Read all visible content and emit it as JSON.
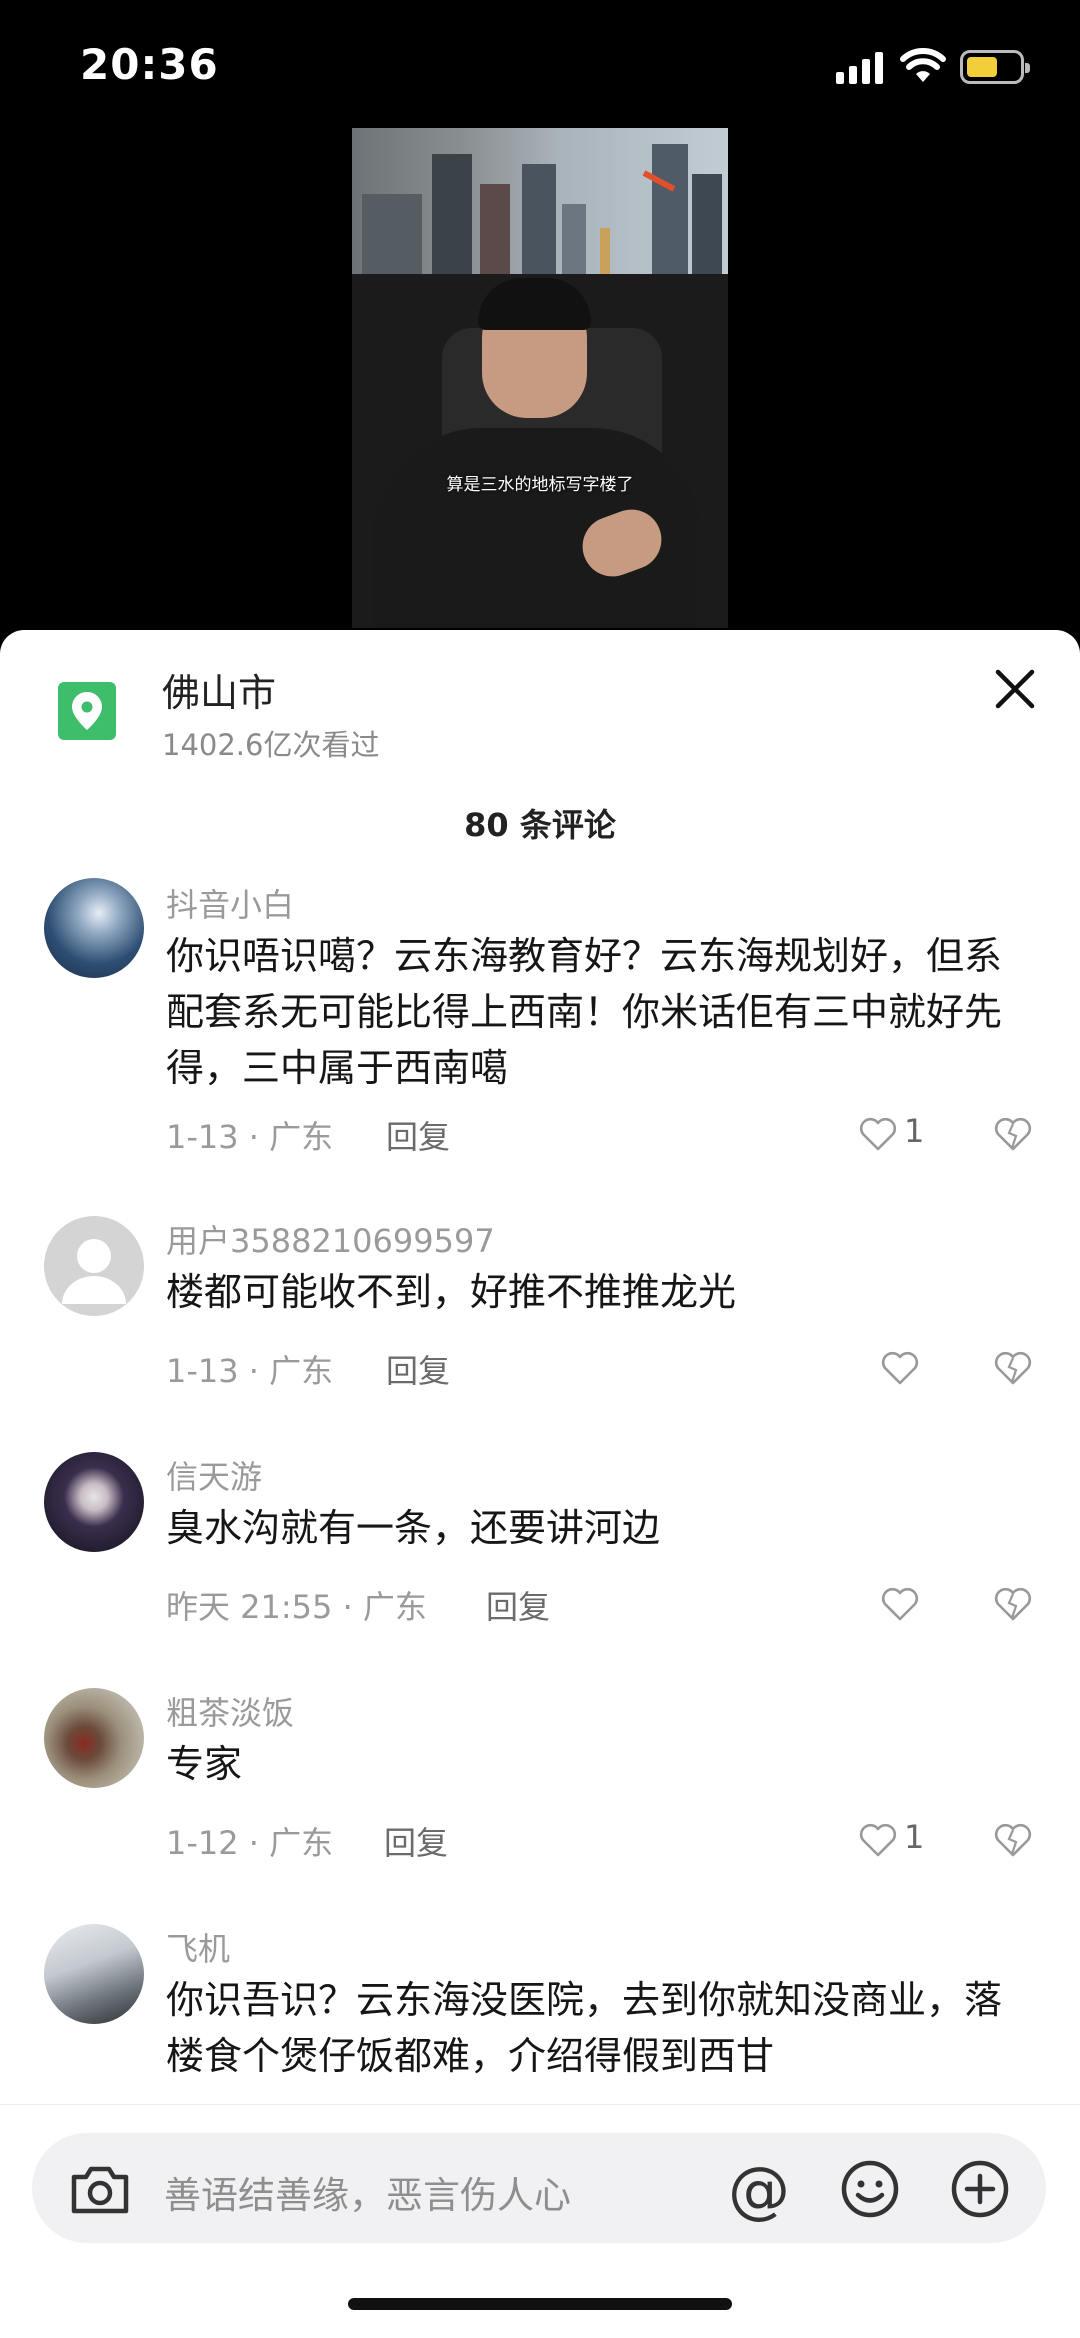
{
  "status_bar": {
    "time": "20:36"
  },
  "video": {
    "caption": "算是三水的地标写字楼了"
  },
  "location": {
    "title": "佛山市",
    "views": "1402.6亿次看过"
  },
  "comments_header": "80 条评论",
  "comments": [
    {
      "user": "抖音小白",
      "text": "你识唔识噶？云东海教育好？云东海规划好，但系配套系无可能比得上西南！你米话佢有三中就好先得，三中属于西南噶",
      "date": "1-13 · 广东",
      "reply": "回复",
      "likes": "1"
    },
    {
      "user": "用户3588210699597",
      "text": "楼都可能收不到，好推不推推龙光",
      "date": "1-13 · 广东",
      "reply": "回复",
      "likes": ""
    },
    {
      "user": "信天游",
      "text": "臭水沟就有一条，还要讲河边",
      "date": "昨天 21:55 · 广东",
      "reply": "回复",
      "likes": ""
    },
    {
      "user": "粗茶淡饭",
      "text": "专家",
      "date": "1-12 · 广东",
      "reply": "回复",
      "likes": "1"
    },
    {
      "user": "飞机",
      "text": "你识吾识？云东海没医院，去到你就知没商业，落楼食个煲仔饭都难，介绍得假到西甘",
      "date": "",
      "reply": "",
      "likes": ""
    }
  ],
  "input": {
    "placeholder": "善语结善缘，恶言伤人心"
  },
  "icons": [
    "location-pin-icon",
    "close-icon",
    "heart-icon",
    "broken-heart-icon",
    "camera-icon",
    "at-icon",
    "emoji-icon",
    "plus-icon",
    "signal-icon",
    "wifi-icon",
    "battery-icon"
  ],
  "colors": {
    "location_green": "#3ebd6a",
    "battery_yellow": "#f2cf3a"
  }
}
